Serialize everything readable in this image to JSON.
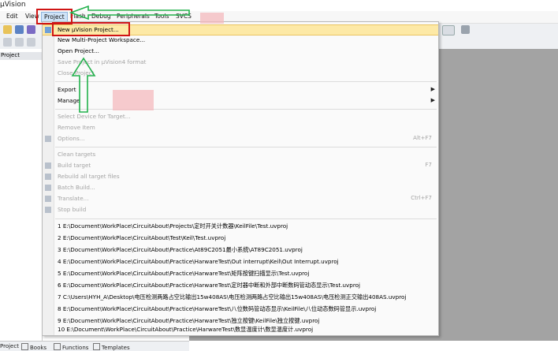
{
  "window": {
    "title": "µVision"
  },
  "menubar": {
    "items": [
      "Edit",
      "View",
      "Project",
      "Flash",
      "Debug",
      "Peripherals",
      "Tools",
      "SVCS"
    ]
  },
  "left_panel": {
    "header": "Project"
  },
  "bottom_tabs": [
    "Project",
    "Books",
    "Functions",
    "Templates"
  ],
  "project_menu": {
    "items": [
      {
        "label": "New µVision Project...",
        "state": "highlighted"
      },
      {
        "label": "New Multi-Project Workspace..."
      },
      {
        "label": "Open Project..."
      },
      {
        "label": "Save Project in µVision4 format",
        "state": "disabled"
      },
      {
        "label": "Close Project",
        "state": "disabled"
      },
      {
        "label": "Export",
        "submenu": true
      },
      {
        "label": "Manage",
        "submenu": true
      },
      {
        "label": "Select Device for Target...",
        "state": "disabled"
      },
      {
        "label": "Remove Item",
        "state": "disabled"
      },
      {
        "label": "Options...",
        "shortcut": "Alt+F7",
        "state": "disabled"
      },
      {
        "label": "Clean targets",
        "state": "disabled"
      },
      {
        "label": "Build target",
        "shortcut": "F7",
        "state": "disabled"
      },
      {
        "label": "Rebuild all target files",
        "state": "disabled"
      },
      {
        "label": "Batch Build...",
        "state": "disabled"
      },
      {
        "label": "Translate...",
        "shortcut": "Ctrl+F7",
        "state": "disabled"
      },
      {
        "label": "Stop build",
        "state": "disabled"
      }
    ],
    "recent": [
      "1 E:\\Document\\WorkPlace\\CircuitAbout\\Projects\\定时开关计数器\\KeilFile\\Test.uvproj",
      "2 E:\\Document\\WorkPlace\\CircuitAbout\\Test\\Keil\\Test.uvproj",
      "3 E:\\Document\\WorkPlace\\CircuitAbout\\Practice\\At89C2051最小系统\\AT89C2051.uvproj",
      "4 E:\\Document\\WorkPlace\\CircuitAbout\\Practice\\HarwareTest\\Out interrupt\\Keil\\Out Interrupt.uvproj",
      "5 E:\\Document\\WorkPlace\\CircuitAbout\\Practice\\HarwareTest\\矩阵按键扫描显示\\Test.uvproj",
      "6 E:\\Document\\WorkPlace\\CircuitAbout\\Practice\\HarwareTest\\定时器中断和外部中断数码管动态显示\\Test.uvproj",
      "7 C:\\Users\\HYH_A\\Desktop\\电压检测两路占空比输出15w408AS\\电压检测两路占空比输出15w408AS\\电压检测正交输出408AS.uvproj",
      "8 E:\\Document\\WorkPlace\\CircuitAbout\\Practice\\HarwareTest\\八位数码管动态显示\\KeilFile\\八位动态数码管显示.uvproj",
      "9 E:\\Document\\WorkPlace\\CircuitAbout\\Practice\\HarwareTest\\独立按键\\KeilFile\\独立按键.uvproj",
      "10 E:\\Document\\WorkPlace\\CircuitAbout\\Practice\\HarwareTest\\数显温度计\\数显温度计.uvproj"
    ]
  },
  "colors": {
    "highlight": "#fde9a6",
    "annotation_red": "#d01515",
    "annotation_green": "#22b14c",
    "workspace_gray": "#a3a3a3"
  }
}
